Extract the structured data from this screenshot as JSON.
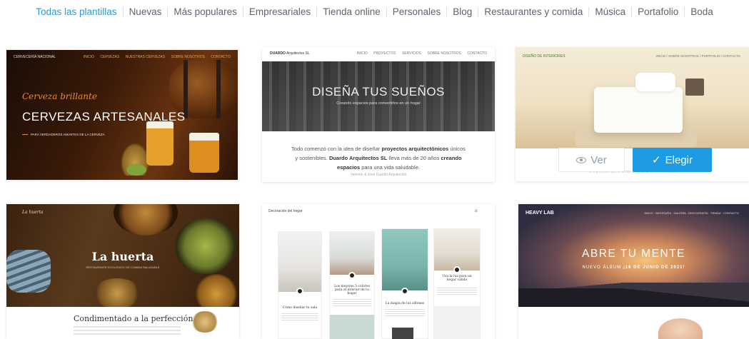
{
  "tabs": [
    {
      "label": "Todas las plantillas",
      "active": true
    },
    {
      "label": "Nuevas"
    },
    {
      "label": "Más populares"
    },
    {
      "label": "Empresariales"
    },
    {
      "label": "Tienda online"
    },
    {
      "label": "Personales"
    },
    {
      "label": "Blog"
    },
    {
      "label": "Restaurantes y comida"
    },
    {
      "label": "Música"
    },
    {
      "label": "Portafolio"
    },
    {
      "label": "Boda"
    }
  ],
  "templates": {
    "cerveceria": {
      "brand": "CERVECERÍA NACIONAL",
      "nav": [
        "INICIO",
        "CERVEZAS",
        "NUESTRAS CERVEZAS",
        "SOBRE NOSOTROS",
        "CONTACTO"
      ],
      "script": "Cerveza brillante",
      "headline": "CERVEZAS ARTESANALES",
      "sub": "PARA VERDADEROS AMANTES DE LA CERVEZA"
    },
    "duardo": {
      "brand": "DUARDO",
      "brand_suffix": "Arquitectos SL",
      "nav": [
        "INICIO",
        "PROYECTOS",
        "SERVICIOS",
        "SOBRE NOSOTROS",
        "CONTACTO"
      ],
      "hero_title": "DISEÑA TUS SUEÑOS",
      "hero_tag": "Creando espacios para convertirlos en un hogar",
      "body_1": "Todo comenzó con la idea de diseñar ",
      "body_b1": "proyectos arquitectónicos",
      "body_2": " únicos y sostenibles. ",
      "body_b2": "Duardo Arquitectos SL",
      "body_3": " lleva más de 20 años ",
      "body_b3": "creando espacios",
      "body_4": " para una vida saludable.",
      "footer": "Valentín & José Duardo Arquitectos"
    },
    "interiores": {
      "brand": "DISEÑO DE INTERIORES",
      "nav": "INICIO / SOBRE NOSOTROS / PORTFOLIO / CONTACTO",
      "caption": "Tu el proyecto que te tienes para soñar tu nuevo espacio",
      "btn_ver": "Ver",
      "btn_elegir": "Elegir"
    },
    "huerta": {
      "brand": "La huerta",
      "title": "La huerta",
      "sub": "RESTAURANTE ECOLÓGICO DE COMIDA SALUDABLE",
      "section_title": "Condimentado a la perfección"
    },
    "decoracion": {
      "brand": "Decoración del hogar",
      "menu_icon": "≡",
      "tiles": [
        {
          "caption": "Cómo diseñar tu sala"
        },
        {
          "caption": "Los mejores 5 colores para el interior de tu hogar"
        },
        {
          "caption": "La magia de los sillones"
        },
        {
          "caption": "Usa la luz para un hogar cálido"
        }
      ]
    },
    "heavylab": {
      "brand": "HEAVY LAB",
      "nav": "INICIO · BIOGRAFÍA · GALERÍA · DISCOGRAFÍA · TIENDA · CONTACTO",
      "title": "ABRE TU MENTE",
      "sub_1": "NUEVO ÁLBUM ",
      "sub_2": "¡16 DE JUNIO DE 2021!"
    }
  },
  "colors": {
    "accent": "#2d9bd4",
    "primary_button": "#1e9ce3"
  }
}
